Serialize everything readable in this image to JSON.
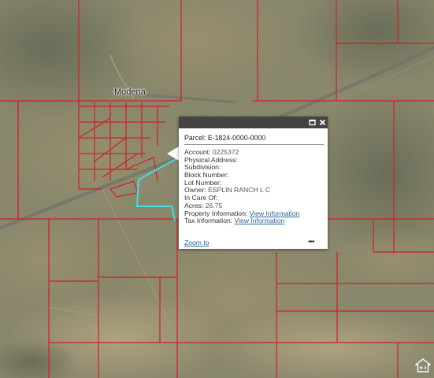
{
  "map": {
    "town_label": "Modena",
    "colors": {
      "parcel_line": "#d21f26",
      "selected_parcel": "#3fe0e0",
      "terrain_base": "#8a8466",
      "road": "#6d7068"
    }
  },
  "popup": {
    "title": "Parcel: E-1824-0000-0000",
    "fields": [
      {
        "label": "Account:",
        "value": "0225372"
      },
      {
        "label": "Physical Address:",
        "value": ""
      },
      {
        "label": "Subdivision:",
        "value": ""
      },
      {
        "label": "Block Number:",
        "value": ""
      },
      {
        "label": "Lot Number:",
        "value": ""
      },
      {
        "label": "Owner:",
        "value": "ESPLIN RANCH L C"
      },
      {
        "label": "In Care Of:",
        "value": ""
      },
      {
        "label": "Acres:",
        "value": "26.75"
      },
      {
        "label": "Property Information:",
        "link": "View Information "
      },
      {
        "label": "Tax Information:",
        "link": "View Information"
      }
    ],
    "zoom_link": "Zoom to",
    "icons": {
      "maximize": "maximize-icon",
      "close": "close-icon",
      "more": "more-options-icon"
    }
  }
}
